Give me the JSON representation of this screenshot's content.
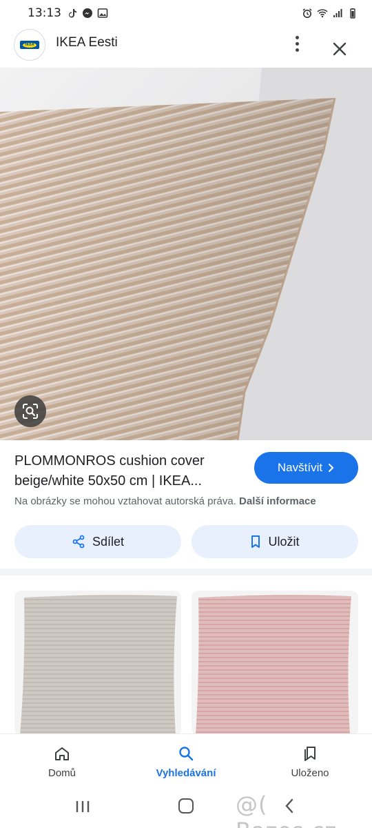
{
  "status_bar": {
    "time": "13:13"
  },
  "header": {
    "site_name": "IKEA Eesti",
    "logo_text": "IKEA"
  },
  "product": {
    "title_line1": "PLOMMONROS cushion cover",
    "title_line2": "beige/white 50x50 cm | IKEA...",
    "visit_label": "Navštívit",
    "copyright_text": "Na obrázky se mohou vztahovat autorská práva.",
    "more_info_label": "Další informace"
  },
  "actions": {
    "share_label": "Sdílet",
    "save_label": "Uložit"
  },
  "bottom_nav": {
    "items": [
      {
        "label": "Domů",
        "icon": "home-icon"
      },
      {
        "label": "Vyhledávání",
        "icon": "search-icon"
      },
      {
        "label": "Uloženo",
        "icon": "saved-icon"
      }
    ],
    "active_index": 1
  },
  "watermark": "@( Bazos.cz",
  "colors": {
    "accent": "#1a73e8",
    "tonal_button": "#e8f0fe",
    "text_primary": "#202124",
    "text_secondary": "#5f6368"
  }
}
